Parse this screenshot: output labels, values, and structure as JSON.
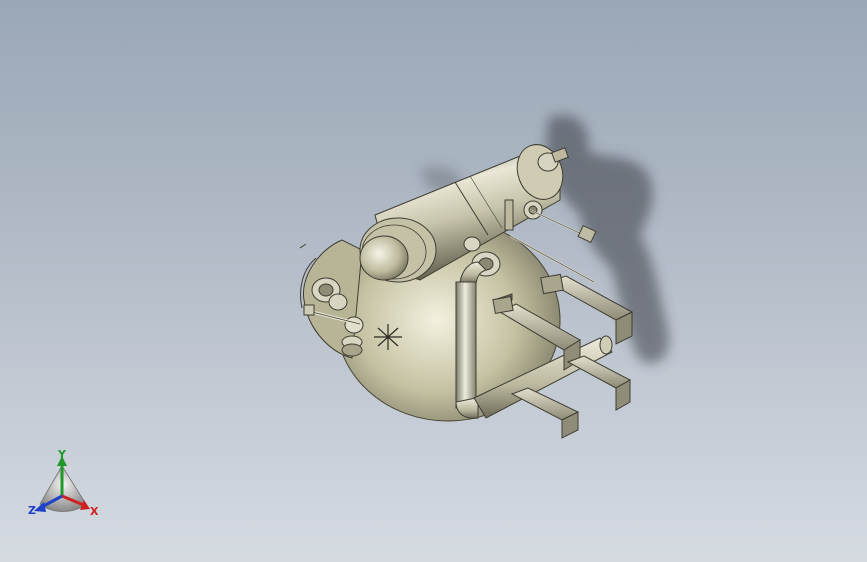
{
  "viewport": {
    "background_top": "#9aa7b6",
    "background_bottom": "#d6dbe2"
  },
  "model": {
    "body_color": "#c9c6a8",
    "pipe_color": "#cfcdb6"
  },
  "triad": {
    "x_label": "X",
    "y_label": "Y",
    "z_label": "Z",
    "x_color": "#d02020",
    "y_color": "#1f9a2a",
    "z_color": "#2040c8"
  }
}
